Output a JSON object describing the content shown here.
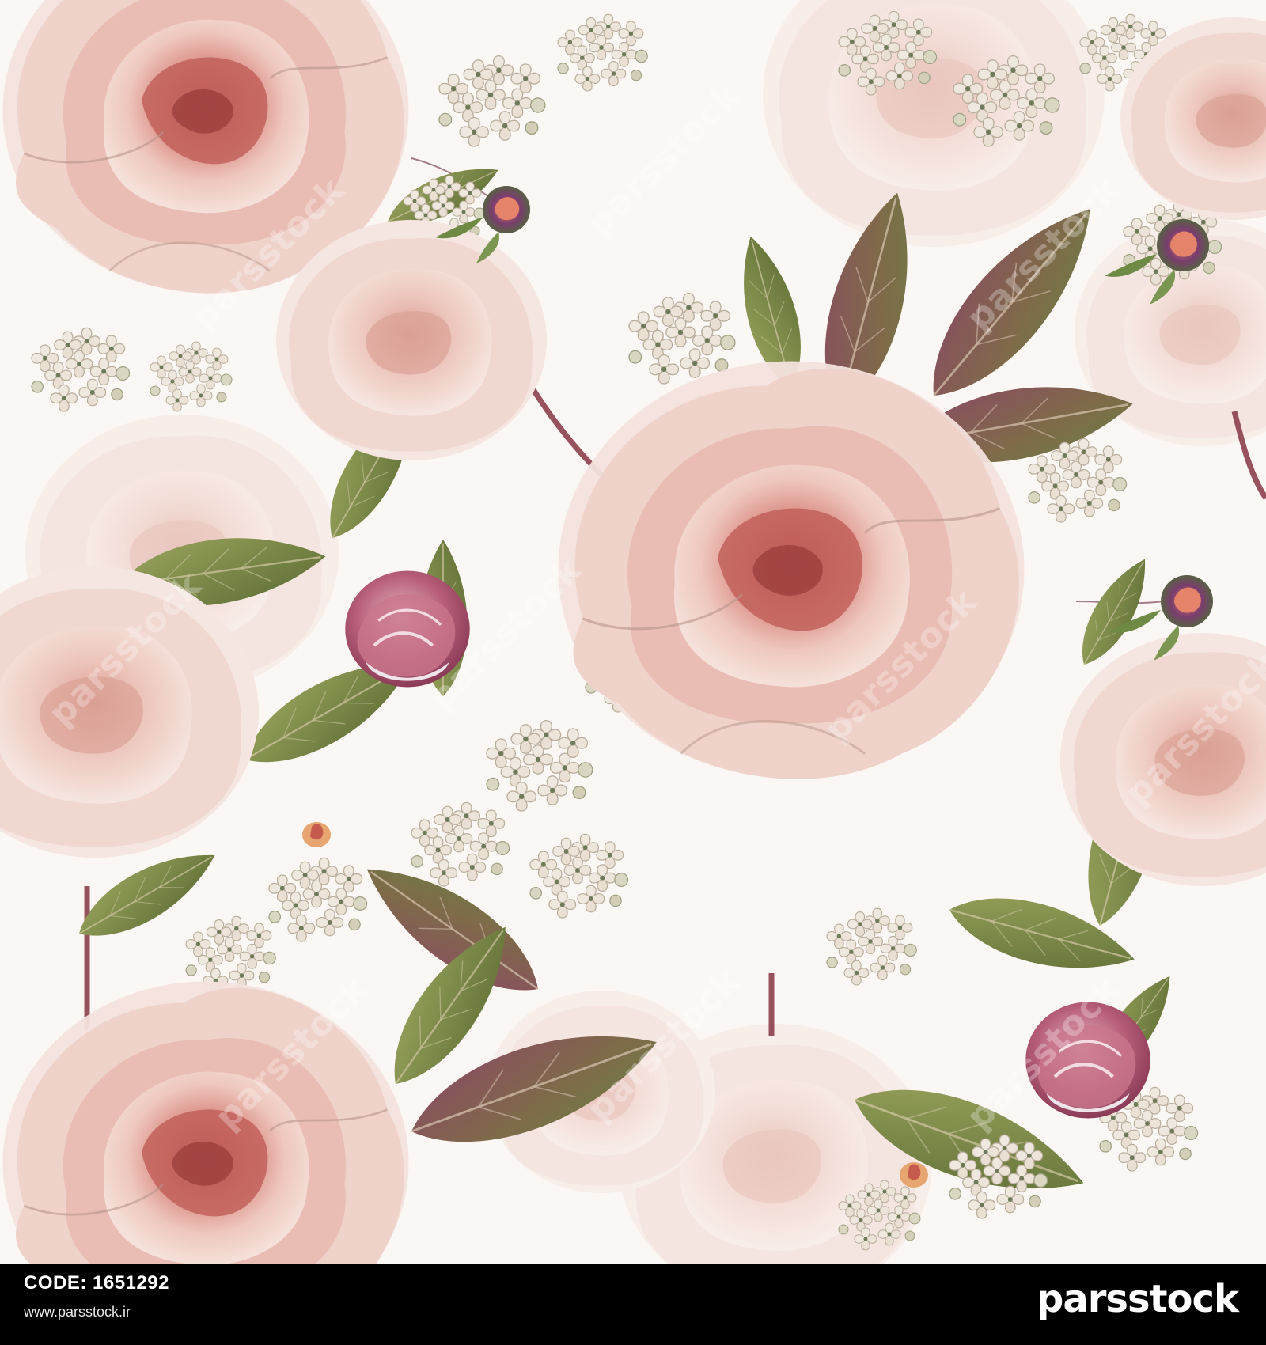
{
  "footer": {
    "code_label": "CODE:",
    "code_value": "1651292",
    "site_url": "www.parsstock.ir",
    "brand": "parsstock"
  },
  "watermark": {
    "text": "parsstock"
  },
  "colors": {
    "background": "#fbf7f4",
    "peony_deep": "#c7625a",
    "peony_mid": "#e3a59b",
    "peony_light": "#f2d6cf",
    "lilac_cream": "#ece6dc",
    "leaf_green": "#7a8a4a",
    "leaf_purple": "#7a3f58",
    "footer_bg": "#000000",
    "footer_text": "#ffffff"
  }
}
